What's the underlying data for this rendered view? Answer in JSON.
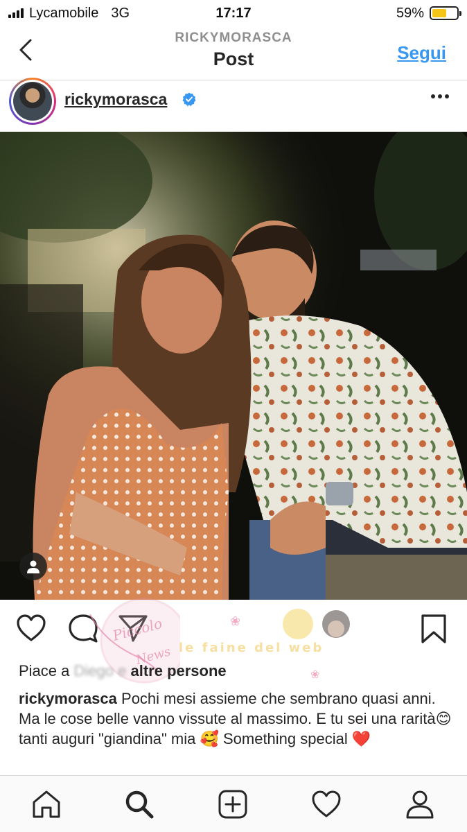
{
  "status_bar": {
    "carrier": "Lycamobile",
    "network": "3G",
    "time": "17:17",
    "battery_percent": "59%",
    "battery_level": 0.59
  },
  "header": {
    "subtitle": "RICKYMORASCA",
    "title": "Post",
    "follow_label": "Segui",
    "back_icon": "chevron-left-icon"
  },
  "post": {
    "username": "rickymorasca",
    "verified": true,
    "more_icon": "more-horizontal-icon"
  },
  "actions": {
    "like_icon": "heart-icon",
    "comment_icon": "comment-icon",
    "share_icon": "paper-plane-icon",
    "save_icon": "bookmark-icon"
  },
  "likes": {
    "prefix": "Piace a",
    "hidden": "Diego e",
    "suffix": "altre persone"
  },
  "caption": {
    "username": "rickymorasca",
    "text_1": "Pochi mesi assieme che sembrano quasi anni. Ma le cose belle vanno vissute al massimo. E tu sei una rarità",
    "emoji_1": "😊",
    "text_2": " tanti auguri \"giandina\" mia ",
    "emoji_2": "🥰",
    "text_3": " Something special ",
    "emoji_3": "❤️"
  },
  "watermark": {
    "left_text": "Il Piccolo delle News",
    "right_text": "le faine del web"
  },
  "tabbar": {
    "items": [
      "home-icon",
      "search-icon",
      "add-post-icon",
      "activity-heart-icon",
      "profile-icon"
    ]
  },
  "colors": {
    "link": "#3897f0",
    "verified": "#3897f0",
    "battery": "#f5c518",
    "text": "#262626",
    "secondary": "#8e8e8e"
  }
}
